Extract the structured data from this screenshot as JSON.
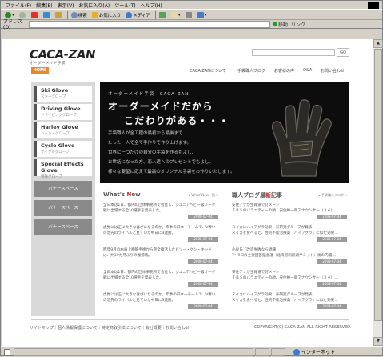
{
  "browser": {
    "menu": [
      "ファイル(F)",
      "編集(E)",
      "表示(V)",
      "お気に入り(A)",
      "ツール(T)",
      "ヘルプ(H)"
    ],
    "toolbar": {
      "search": "検索",
      "favorites": "お気に入り",
      "media": "メディア"
    },
    "address_label": "アドレス(D)",
    "address_value": "",
    "go_label": "移動",
    "links_label": "リンク",
    "status_zone": "インターネット"
  },
  "site": {
    "logo_text": "CACA-ZAN",
    "logo_sub": "オーダーメイド手袋",
    "search_button": "GO",
    "nav": {
      "home": "HOME",
      "items": [
        "CACA-ZANについて",
        "手袋職人ブログ",
        "お客様の声",
        "Q&A",
        "お問い合わせ"
      ]
    },
    "sidebar": {
      "cards": [
        {
          "title": "Ski Glove",
          "sub": "スキーグローブ"
        },
        {
          "title": "Driving Glove",
          "sub": "ドライビンググローブ"
        },
        {
          "title": "Harley Glove",
          "sub": "ハーレーグローブ"
        },
        {
          "title": "Cycle Glove",
          "sub": "サイクルグローブ"
        },
        {
          "title": "Special Effects Glove",
          "sub": "特殊グローブ"
        }
      ],
      "banners": [
        "バナースペース",
        "バナースペース",
        "バナースペース"
      ]
    },
    "hero": {
      "small": "オーダーメイド手袋　CACA-ZAN",
      "headline1": "オーダーメイドだから",
      "headline2": "こだわりがある・・・",
      "lines": [
        "手袋職人が全工程の最初から最後まで",
        "たった一人で全て手作りで作り上げます。",
        "世界に一つだけの自分の手袋を作るもよし、",
        "お世話になった方、恋人達へのプレゼントでもよし。",
        "様々な要望に応えて最高のオリジナル手袋をお作りいたします。"
      ]
    },
    "news": {
      "title_pre": "What's ",
      "title_acc": "N",
      "title_post": "ew",
      "more": "▸ What' New一覧へ",
      "items": [
        {
          "text": "全日本は1日、都内の団体事務所で会見し、ジュニアヘビー級リーグ戦に出場する全10選手を発表した。",
          "date": "2008-07-04"
        },
        {
          "text": "虎党には正に大きな喜びになるのか。昨季の日本一チームで、V奪いの急先のライバルと見ていた中日に3連勝。",
          "date": "2008-07-04"
        },
        {
          "text": "昨年9月の右肩上腕筋手術から完全復活したビリー・ケン・キッドは、約10カ月ぶりの復帰戦。",
          "date": "2008-07-04"
        },
        {
          "text": "全日本は1日、都内の団体事務所で会見し、ジュニアヘビー級リーグ戦に出場する全10選手を発表した。",
          "date": "2008-07-04"
        },
        {
          "text": "虎党には正に大きな喜びになるのか。昨季の日本一チームで、V奪いの急先のライバルと見ていた中日に3連勝。",
          "date": "2008-07-04"
        }
      ]
    },
    "blog": {
      "title_pre": "職人ブログ最",
      "title_acc": "新",
      "title_post": "記事",
      "more": "▸ 手袋職人ブログへ",
      "items": [
        {
          "text": "安住アナが生報道で釘メーン\nＴＢＳのバラエティーの顔、安住紳一郎アナウンサー（３４）…",
          "date": "2008-07-04"
        },
        {
          "text": "スイカにハイアグラ効果　米研究グループが発表\nスイカを食べると、性的不能治療薬「バイアグラ」に似た効果…",
          "date": "2008-07-04"
        },
        {
          "text": "小泉氏「改造失敗なら退陣」\n7～9日の主要国首脳会議（北海道洞爺湖サミット）後の内閣…",
          "date": "2008-07-04"
        },
        {
          "text": "安住アナが生報道で釘メーン\nＴＢＳのバラエティーの顔、安住紳一郎アナウンサー（３４）…",
          "date": "2008-07-04"
        },
        {
          "text": "スイカにハイアグラ効果　米研究グループが発表\nスイカを食べると、性的不能治療薬「バイアグラ」に似た効果…",
          "date": "2008-07-04"
        }
      ]
    },
    "footer": {
      "links": "サイトマップ｜個人情報保護について｜特定商取引法について｜会社概要｜お問い合わせ",
      "copyright": "COPYRIGHT(C) CACA-ZAN ALL RIGHT RESERVED."
    }
  }
}
